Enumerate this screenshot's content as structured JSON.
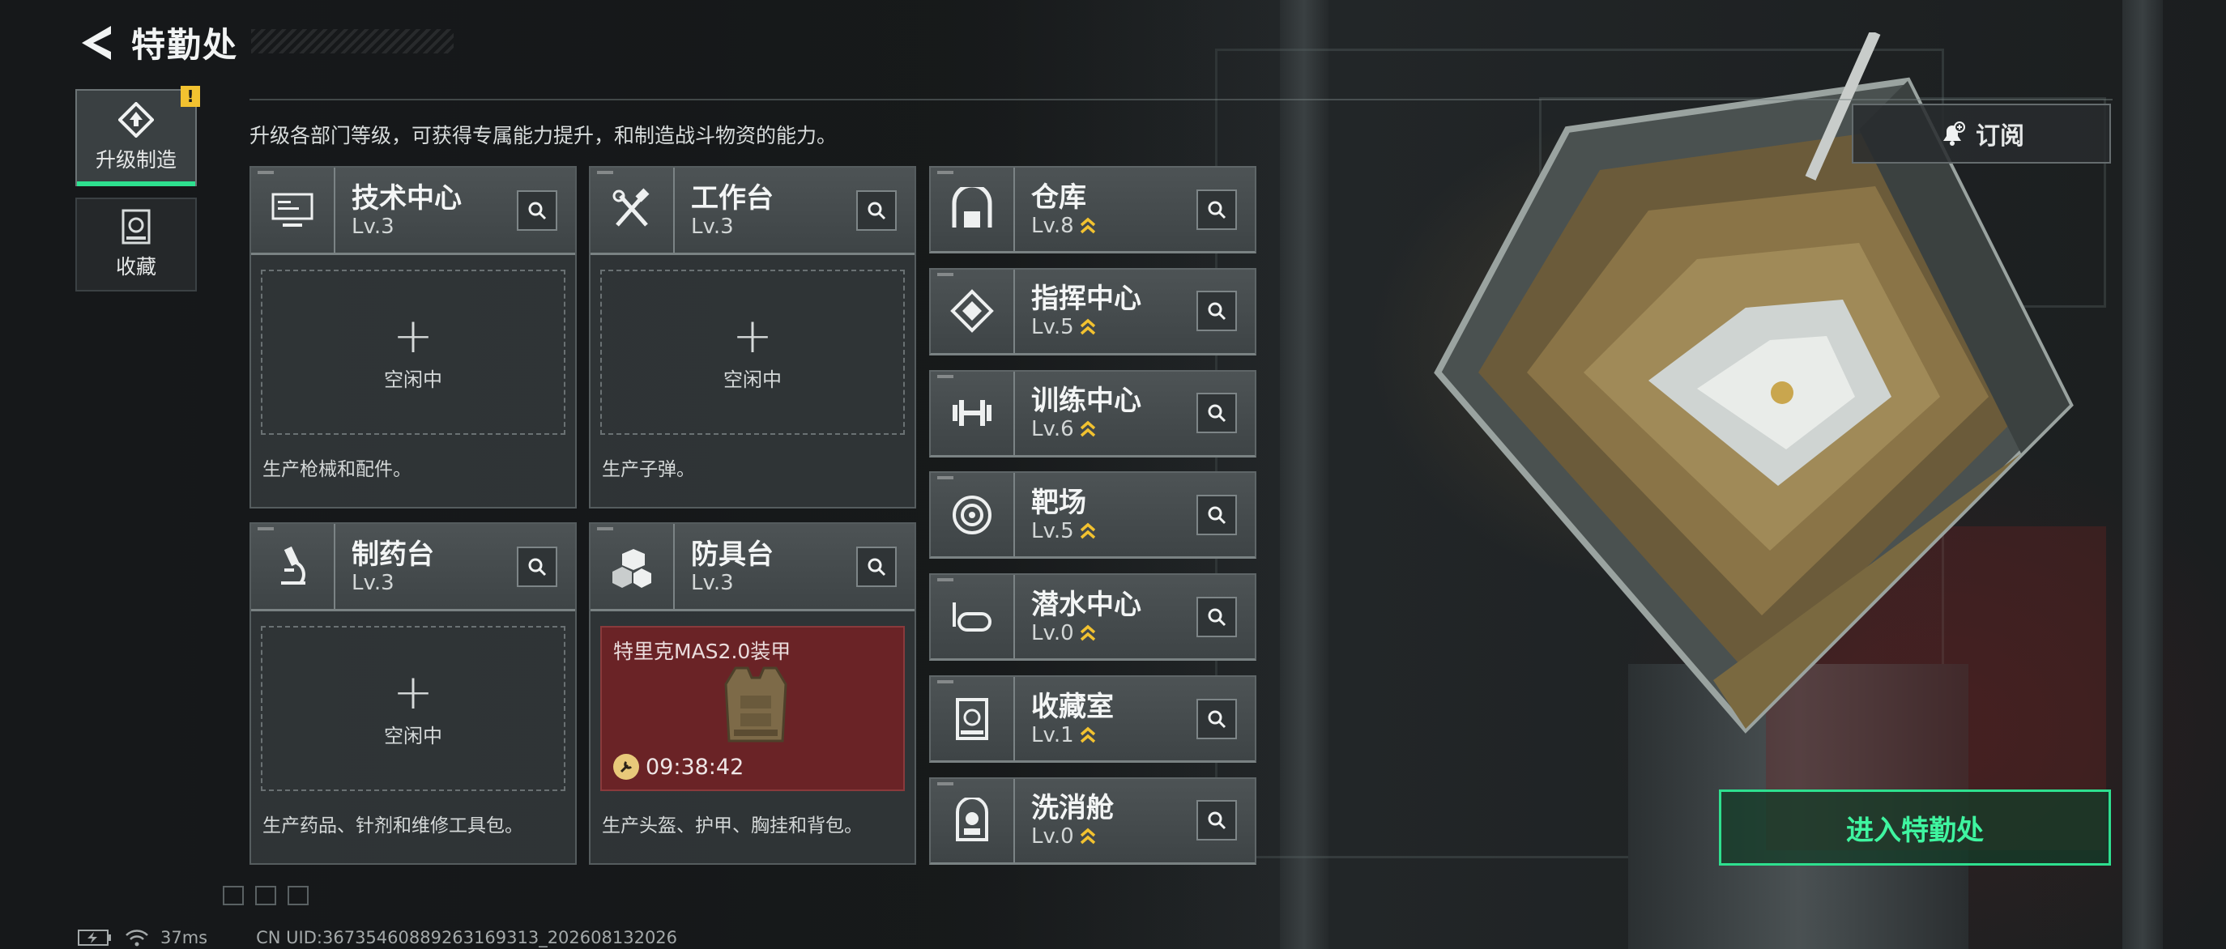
{
  "header": {
    "title": "特勤处"
  },
  "nav": {
    "items": [
      {
        "label": "升级制造",
        "badge": "!"
      },
      {
        "label": "收藏"
      }
    ]
  },
  "description": "升级各部门等级，可获得专属能力提升，和制造战斗物资的能力。",
  "production": [
    {
      "name": "技术中心",
      "level": "Lv.3",
      "icon": "computer-icon",
      "slot_plus": "+",
      "slot_status": "空闲中",
      "desc": "生产枪械和配件。"
    },
    {
      "name": "工作台",
      "level": "Lv.3",
      "icon": "tools-icon",
      "slot_plus": "+",
      "slot_status": "空闲中",
      "desc": "生产子弹。"
    },
    {
      "name": "制药台",
      "level": "Lv.3",
      "icon": "microscope-icon",
      "slot_plus": "+",
      "slot_status": "空闲中",
      "desc": "生产药品、针剂和维修工具包。"
    },
    {
      "name": "防具台",
      "level": "Lv.3",
      "icon": "armor-blocks-icon",
      "item_name": "特里克MAS2.0装甲",
      "timer": "09:38:42",
      "desc": "生产头盔、护甲、胸挂和背包。"
    }
  ],
  "facilities": [
    {
      "name": "仓库",
      "level": "Lv.8",
      "icon": "warehouse-icon"
    },
    {
      "name": "指挥中心",
      "level": "Lv.5",
      "icon": "command-icon"
    },
    {
      "name": "训练中心",
      "level": "Lv.6",
      "icon": "dumbbell-icon"
    },
    {
      "name": "靶场",
      "level": "Lv.5",
      "icon": "target-icon"
    },
    {
      "name": "潜水中心",
      "level": "Lv.0",
      "icon": "diving-mask-icon"
    },
    {
      "name": "收藏室",
      "level": "Lv.1",
      "icon": "collection-icon"
    },
    {
      "name": "洗消舱",
      "level": "Lv.0",
      "icon": "decon-icon"
    }
  ],
  "subscribe_label": "订阅",
  "enter_label": "进入特勤处",
  "status": {
    "ping": "37ms",
    "uid": "CN UID:36735460889263169313_202608132026"
  },
  "colors": {
    "accent": "#2ee08f",
    "badge": "#f2c230",
    "upgrade": "#f2c230",
    "production_active": "#6a2326"
  }
}
